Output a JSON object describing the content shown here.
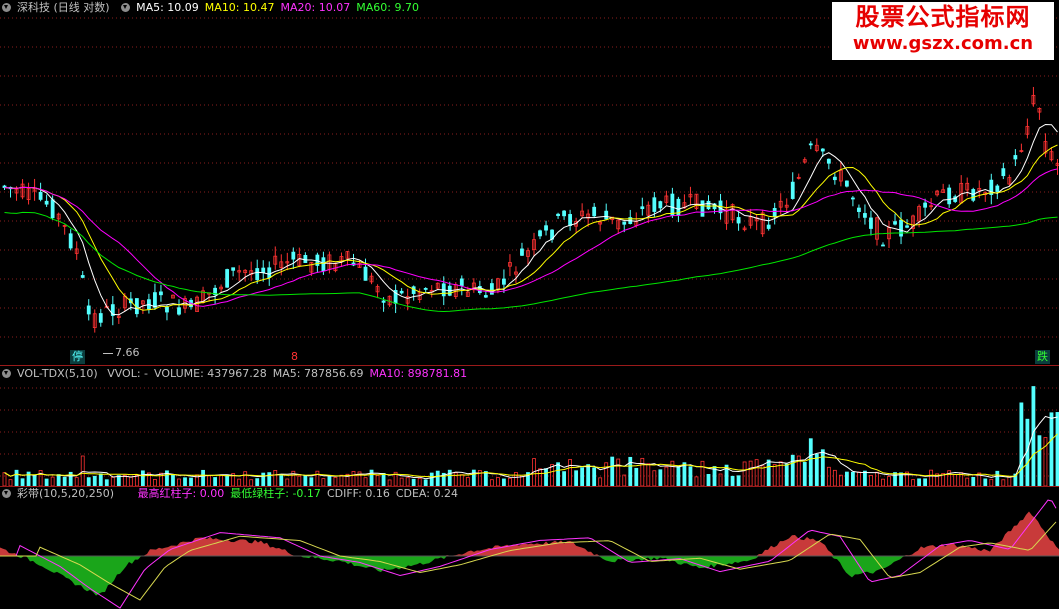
{
  "colors": {
    "up": "#ff3232",
    "down": "#54ffff",
    "ma5": "#ffffff",
    "ma10": "#ffff00",
    "ma20": "#ff00ff",
    "ma60": "#00e600",
    "grid": "#8a1e1e"
  },
  "price_panel": {
    "title": "深科技 (日线 对数)",
    "indicators": [
      {
        "label": "MA5: 10.09",
        "color": "#ffffff"
      },
      {
        "label": "MA10: 10.47",
        "color": "#ffff00"
      },
      {
        "label": "MA20: 10.07",
        "color": "#ff33ff"
      },
      {
        "label": "MA60: 9.70",
        "color": "#33ff33"
      }
    ],
    "low_label": "7.66",
    "tags": [
      {
        "text": "停",
        "color": "#54ffff"
      },
      {
        "text": "8",
        "color": "#ff3232"
      },
      {
        "text": "跌",
        "color": "#33ff33"
      }
    ]
  },
  "watermark": {
    "line1": "股票公式指标网",
    "line2": "www.gszx.com.cn"
  },
  "volume_panel": {
    "title": "VOL-TDX(5,10)",
    "items": [
      {
        "label": "VVOL: -",
        "color": "#c0c0c0"
      },
      {
        "label": "VOLUME: 437967.28",
        "color": "#c0c0c0"
      },
      {
        "label": "MA5: 787856.69",
        "color": "#c0c0c0"
      },
      {
        "label": "MA10: 898781.81",
        "color": "#ff33ff"
      }
    ]
  },
  "band_panel": {
    "title": "彩带(10,5,20,250)",
    "items": [
      {
        "label": "最高红柱子: 0.00",
        "color": "#ff33ff"
      },
      {
        "label": "最低绿柱子: -0.17",
        "color": "#33ff33"
      },
      {
        "label": "CDIFF: 0.16",
        "color": "#c0c0c0"
      },
      {
        "label": "CDEA: 0.24",
        "color": "#c0c0c0"
      }
    ]
  }
}
